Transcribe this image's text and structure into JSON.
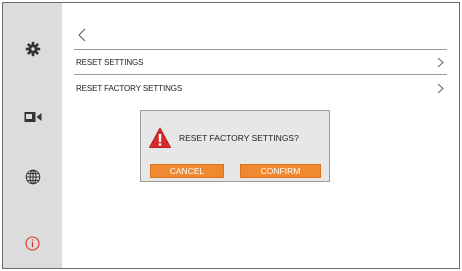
{
  "sidebar": {
    "items": [
      {
        "icon": "gear-icon"
      },
      {
        "icon": "camera-icon"
      },
      {
        "icon": "globe-icon"
      },
      {
        "icon": "info-icon",
        "color": "#e0322b"
      }
    ]
  },
  "header": {
    "back_icon": "back-icon"
  },
  "settings": {
    "items": [
      {
        "label": "RESET SETTINGS"
      },
      {
        "label": "RESET FACTORY SETTINGS"
      }
    ]
  },
  "dialog": {
    "title": "RESET FACTORY SETTINGS?",
    "icon": "warning-icon",
    "cancel_label": "CANCEL",
    "confirm_label": "CONFIRM"
  },
  "colors": {
    "sidebar_bg": "#dcdcdc",
    "accent": "#f08a30",
    "warning": "#d62b2b"
  }
}
